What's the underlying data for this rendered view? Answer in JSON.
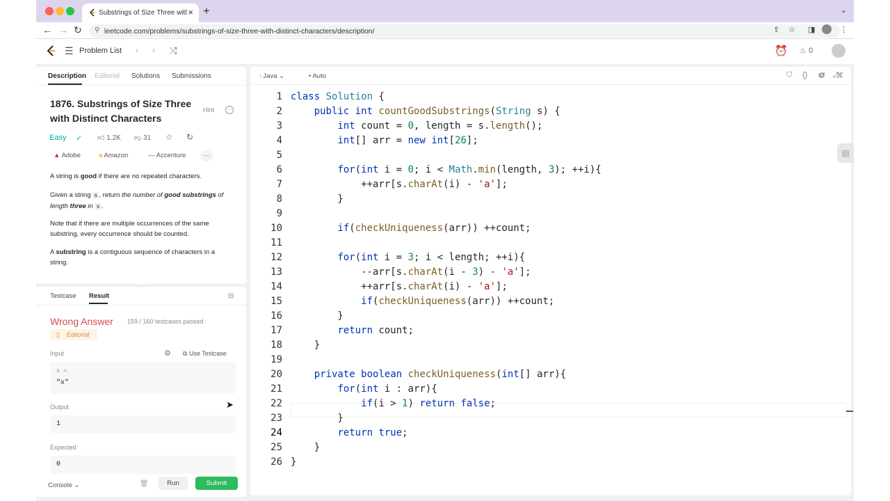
{
  "browser": {
    "tab_title": "Substrings of Size Three with Distinct Characters",
    "url": "leetcode.com/problems/substrings-of-size-three-with-distinct-characters/description/"
  },
  "topbar": {
    "problem_list": "Problem List",
    "streak_count": "0"
  },
  "description": {
    "tabs": [
      "Description",
      "Editorial",
      "Solutions",
      "Submissions"
    ],
    "title": "1876. Substrings of Size Three with Distinct Characters",
    "hint": "Hint",
    "difficulty": "Easy",
    "likes": "1.2K",
    "dislikes": "31",
    "companies": [
      "Adobe",
      "Amazon",
      "Accenture"
    ],
    "more_label": "···",
    "p1_a": "A string is ",
    "p1_b": "good",
    "p1_c": " if there are no repeated characters.",
    "p2_a": "Given a string ",
    "p2_code": "s",
    "p2_b": ", return ",
    "p2_c": "the number of ",
    "p2_d": "good substrings",
    "p2_e": " of length ",
    "p2_f": "three",
    "p2_g": " in ",
    "p2_code2": "s",
    "p2_h": ".",
    "p3": "Note that if there are multiple occurrences of the same substring, every occurrence should be counted.",
    "p4_a": "A ",
    "p4_b": "substring",
    "p4_c": " is a contiguous sequence of characters in a string."
  },
  "testpanel": {
    "tabs": [
      "Testcase",
      "Result"
    ],
    "verdict": "Wrong Answer",
    "passed": "159 / 160  testcases passed",
    "editorial": "Editorial",
    "input_label": "Input",
    "use_testcase": "Use Testcase",
    "input_var": "s =",
    "input_value": "\"x\"",
    "output_label": "Output",
    "output_value": "1",
    "expected_label": "Expected",
    "expected_value": "0",
    "console": "Console",
    "run": "Run",
    "submit": "Submit"
  },
  "editor": {
    "language": "Java",
    "mode": "Auto"
  },
  "colors": {
    "accent_green": "#2cbb5d",
    "easy": "#00af9b",
    "wrong": "#d34f4f"
  }
}
